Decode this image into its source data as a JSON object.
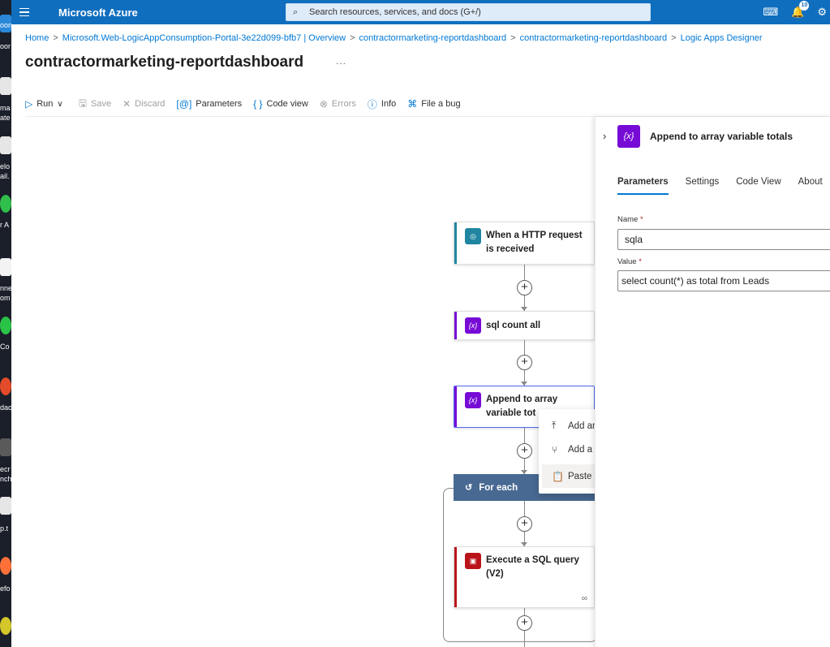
{
  "topbar": {
    "brand": "Microsoft Azure",
    "search_placeholder": "Search resources, services, and docs (G+/)",
    "notification_count": "10"
  },
  "breadcrumb": [
    "Home",
    "Microsoft.Web-LogicAppConsumption-Portal-3e22d099-bfb7 | Overview",
    "contractormarketing-reportdashboard",
    "contractormarketing-reportdashboard",
    "Logic Apps Designer"
  ],
  "page": {
    "title": "contractormarketing-reportdashboard",
    "more": "..."
  },
  "toolbar": {
    "run": "Run",
    "save": "Save",
    "discard": "Discard",
    "parameters": "Parameters",
    "code_view": "Code view",
    "errors": "Errors",
    "info": "Info",
    "file_bug": "File a bug"
  },
  "workflow": {
    "step1": "When a HTTP request is received",
    "step2": "sql count all",
    "step3": "Append to array variable totals",
    "step3_visible": "Append to array variable tot",
    "foreach": "For each",
    "step4": "Execute a SQL query (V2)"
  },
  "context_menu": {
    "add_action": "Add an action",
    "add_parallel": "Add a parallel branch",
    "paste_action": "Paste an action"
  },
  "panel": {
    "title": "Append to array variable totals",
    "tabs": [
      "Parameters",
      "Settings",
      "Code View",
      "About"
    ],
    "name_label": "Name",
    "name_value": "sqla",
    "value_label": "Value",
    "value_value": "select count(*) as total from Leads",
    "required_mark": "*"
  },
  "desktop_strip": {
    "labels": [
      "oon",
      "oor",
      "ma",
      "ate",
      "elo",
      "ail.",
      "r A",
      "nne",
      "om",
      "Co",
      "dac",
      "ecr",
      "nch",
      "p.t",
      "efo"
    ]
  },
  "colors": {
    "azure_blue": "#106ebe",
    "http_teal": "#1f85a1",
    "variable_purple": "#770bd6",
    "foreach_header": "#486991",
    "sql_red": "#ba141a"
  }
}
